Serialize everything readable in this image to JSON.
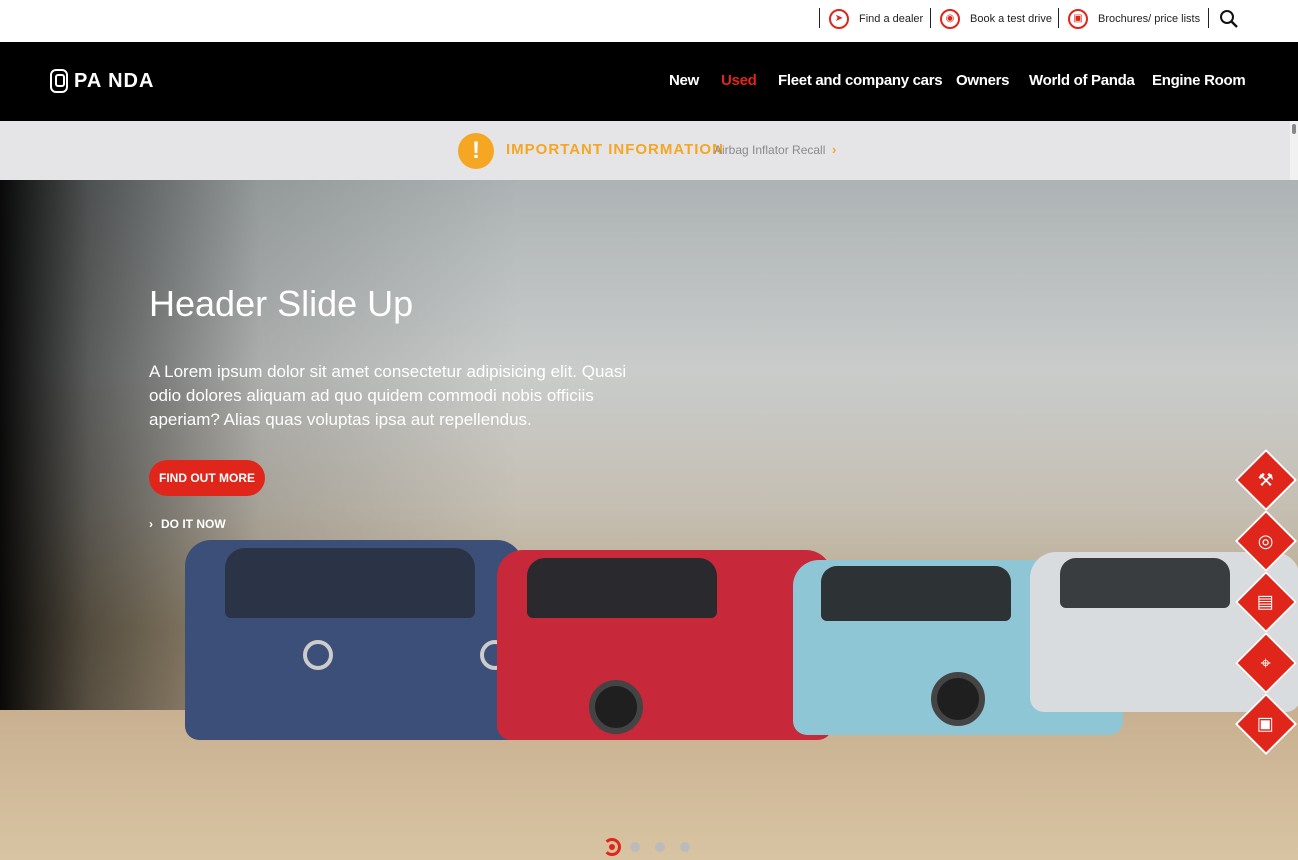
{
  "utility_nav": {
    "items": [
      {
        "label": "Find a dealer",
        "icon": "navigation-arrow-icon"
      },
      {
        "label": "Book a test drive",
        "icon": "steering-wheel-icon"
      },
      {
        "label": "Brochures/ price lists",
        "icon": "brochure-icon"
      }
    ],
    "search_icon": "search-icon"
  },
  "brand": {
    "name": "PA NDA"
  },
  "main_nav": {
    "items": [
      {
        "label": "New"
      },
      {
        "label": "Used"
      },
      {
        "label": "Fleet and company cars"
      },
      {
        "label": "Owners"
      },
      {
        "label": "World of Panda"
      },
      {
        "label": "Engine Room"
      }
    ],
    "active": "Used"
  },
  "info_bar": {
    "icon": "exclamation-icon",
    "title": "IMPORTANT INFORMATION",
    "link": "Airbag Inflator Recall"
  },
  "hero": {
    "title": "Header Slide Up",
    "text": "A Lorem ipsum dolor sit amet consectetur adipisicing elit. Quasi odio dolores aliquam ad quo quidem commodi nobis officiis aperiam? Alias quas voluptas ipsa aut repellendus.",
    "cta_label": "FIND OUT MORE",
    "secondary_label": "DO IT NOW"
  },
  "side_actions": [
    {
      "icon": "wrench-icon"
    },
    {
      "icon": "steering-wheel-icon"
    },
    {
      "icon": "document-icon"
    },
    {
      "icon": "location-pin-icon"
    },
    {
      "icon": "contact-card-icon"
    }
  ],
  "carousel": {
    "slides": 4,
    "active_index": 0
  },
  "colors": {
    "accent": "#e0261a",
    "warning": "#f5a623",
    "nav_bg": "#000000",
    "info_bg": "#e5e5e8"
  }
}
